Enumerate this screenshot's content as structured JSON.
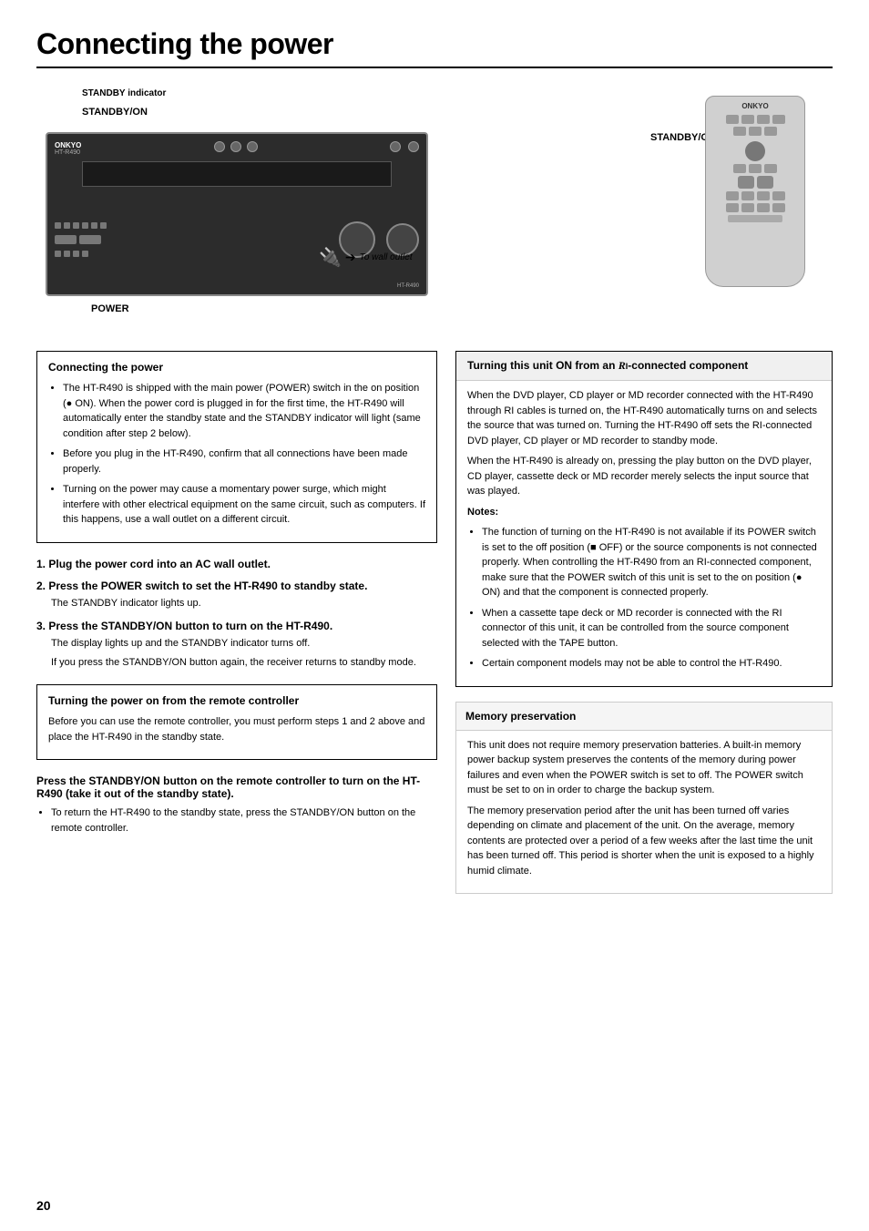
{
  "page": {
    "title": "Connecting the power",
    "number": "20"
  },
  "diagram": {
    "standby_indicator_label": "STANDBY indicator",
    "standby_on_label": "STANDBY/ON",
    "standby_on_remote_label": "STANDBY/ON",
    "power_label": "POWER",
    "to_wall_outlet_label": "To wall outlet",
    "receiver_model": "HT-R490",
    "remote_logo": "ONKYO"
  },
  "left_section": {
    "title": "Connecting the power",
    "bullets": [
      "The HT-R490 is shipped with the main power (POWER) switch in the on position (● ON). When the power cord is plugged in for the first time, the HT-R490 will automatically enter the standby state and the STANDBY indicator will light (same condition after step 2 below).",
      "Before you plug in the HT-R490, confirm that all connections have been made properly.",
      "Turning on the power may cause a momentary power surge, which might interfere with other electrical equipment on the same circuit, such as computers. If this happens, use a wall outlet on a different circuit."
    ],
    "steps": [
      {
        "number": "1.",
        "title": "Plug the power cord into an AC wall outlet."
      },
      {
        "number": "2.",
        "title": "Press the POWER switch to set the HT-R490 to standby state.",
        "desc": "The STANDBY indicator lights up."
      },
      {
        "number": "3.",
        "title": "Press the STANDBY/ON button to turn on the HT-R490.",
        "desc1": "The display lights up and the STANDBY indicator turns off.",
        "desc2": "If you press the STANDBY/ON button again, the receiver returns to standby mode."
      }
    ]
  },
  "remote_section": {
    "title": "Turning the power on from the remote controller",
    "intro": "Before you can use the remote controller, you must perform steps 1 and 2 above and place the HT-R490 in the standby state.",
    "instruction_title": "Press the STANDBY/ON button on the remote controller to turn on the HT-R490 (take it out of the standby state).",
    "bullet": "To return the HT-R490 to the standby state, press the STANDBY/ON button on the remote controller."
  },
  "right_section": {
    "ri_title": "Turning this unit ON from an RI-connected component",
    "ri_body1": "When the DVD player, CD player or MD recorder connected with the HT-R490 through RI cables is turned on, the HT-R490 automatically turns on and selects the source that was turned on. Turning the HT-R490 off sets the RI-connected DVD player, CD player or MD recorder to standby mode.",
    "ri_body2": "When the HT-R490 is already on, pressing the play button on the DVD player, CD player, cassette deck or MD recorder merely selects the input source that was played.",
    "notes_title": "Notes:",
    "notes": [
      "The function of turning on the HT-R490 is not available if its POWER switch is set to the off position (■ OFF) or the source components is not connected properly. When controlling the HT-R490 from an RI-connected component, make sure that the POWER switch of this unit is set to the on position (● ON) and that the component is connected properly.",
      "When a cassette tape deck or MD recorder is connected with the RI connector of this unit, it can be controlled from the source component selected with the TAPE button.",
      "Certain component models may not be able to control the HT-R490."
    ],
    "memory_title": "Memory preservation",
    "memory_body1": "This unit does not require memory preservation batteries. A built-in memory power backup system preserves the contents of the memory during power failures and even when the POWER switch is set to off. The POWER switch must be set to on in order to charge the backup system.",
    "memory_body2": "The memory preservation period after the unit has been turned off varies depending on climate and placement of the unit. On the average, memory contents are protected over a period of a few weeks after the last time the unit has been turned off. This period is shorter when the unit is exposed to a highly humid climate."
  }
}
